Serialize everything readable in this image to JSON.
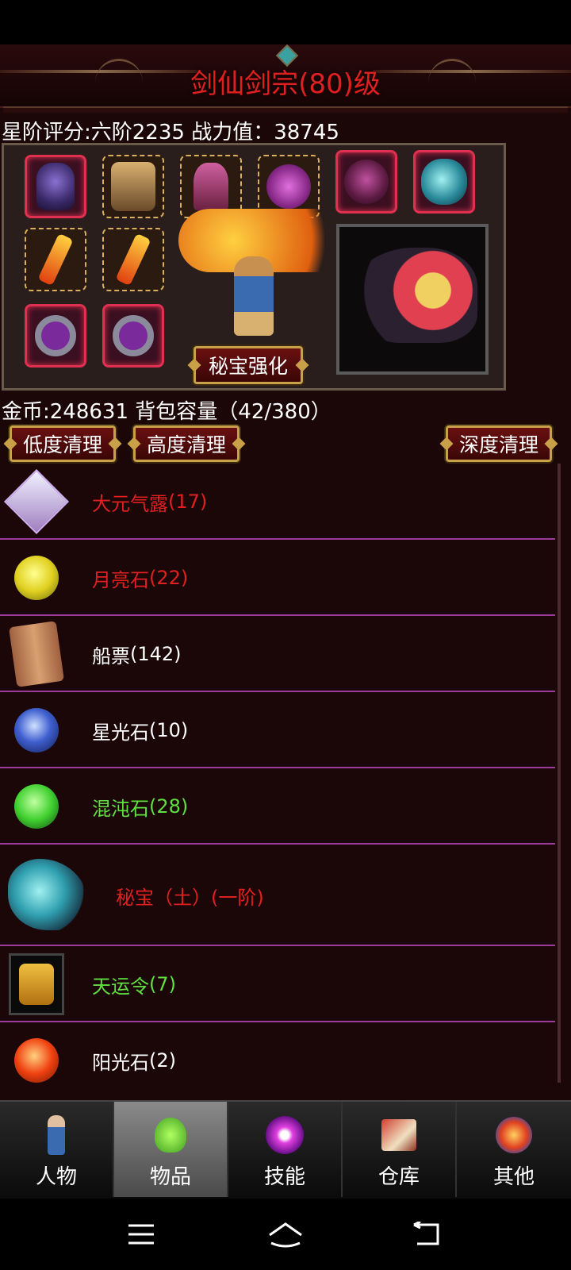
{
  "title": "剑仙剑宗(80)级",
  "rating_line": "星阶评分:六阶2235  战力值：38745",
  "treasure_button": "秘宝强化",
  "info_line": "金币:248631  背包容量（42/380）",
  "clean_buttons": {
    "low": "低度清理",
    "high": "高度清理",
    "deep": "深度清理"
  },
  "items": [
    {
      "name": "大元气露",
      "count": "(17)",
      "color": "#e02020",
      "icon": "potion-icon"
    },
    {
      "name": "月亮石",
      "count": "(22)",
      "color": "#e02020",
      "icon": "moonstone-icon"
    },
    {
      "name": "船票",
      "count": "(142)",
      "color": "#ffffff",
      "icon": "ticket-scroll-icon"
    },
    {
      "name": "星光石",
      "count": "(10)",
      "color": "#ffffff",
      "icon": "starlight-stone-icon"
    },
    {
      "name": "混沌石",
      "count": "(28)",
      "color": "#60e040",
      "icon": "chaos-stone-icon"
    },
    {
      "name": "秘宝（土）",
      "count": "(一阶)",
      "color": "#e02020",
      "icon": "treasure-beast-icon"
    },
    {
      "name": "天运令",
      "count": "(7)",
      "color": "#60e040",
      "icon": "fortune-token-icon"
    },
    {
      "name": "阳光石",
      "count": "(2)",
      "color": "#ffffff",
      "icon": "sunstone-icon"
    }
  ],
  "tabs": [
    {
      "label": "人物",
      "icon": "character-icon"
    },
    {
      "label": "物品",
      "icon": "items-potion-icon"
    },
    {
      "label": "技能",
      "icon": "skills-icon"
    },
    {
      "label": "仓库",
      "icon": "warehouse-icon"
    },
    {
      "label": "其他",
      "icon": "other-icon"
    }
  ],
  "active_tab": "物品",
  "colors": {
    "title": "#e02020",
    "red_item": "#e02020",
    "green_item": "#60e040",
    "divider": "#9a3a9a",
    "button_border": "#c8a048"
  }
}
